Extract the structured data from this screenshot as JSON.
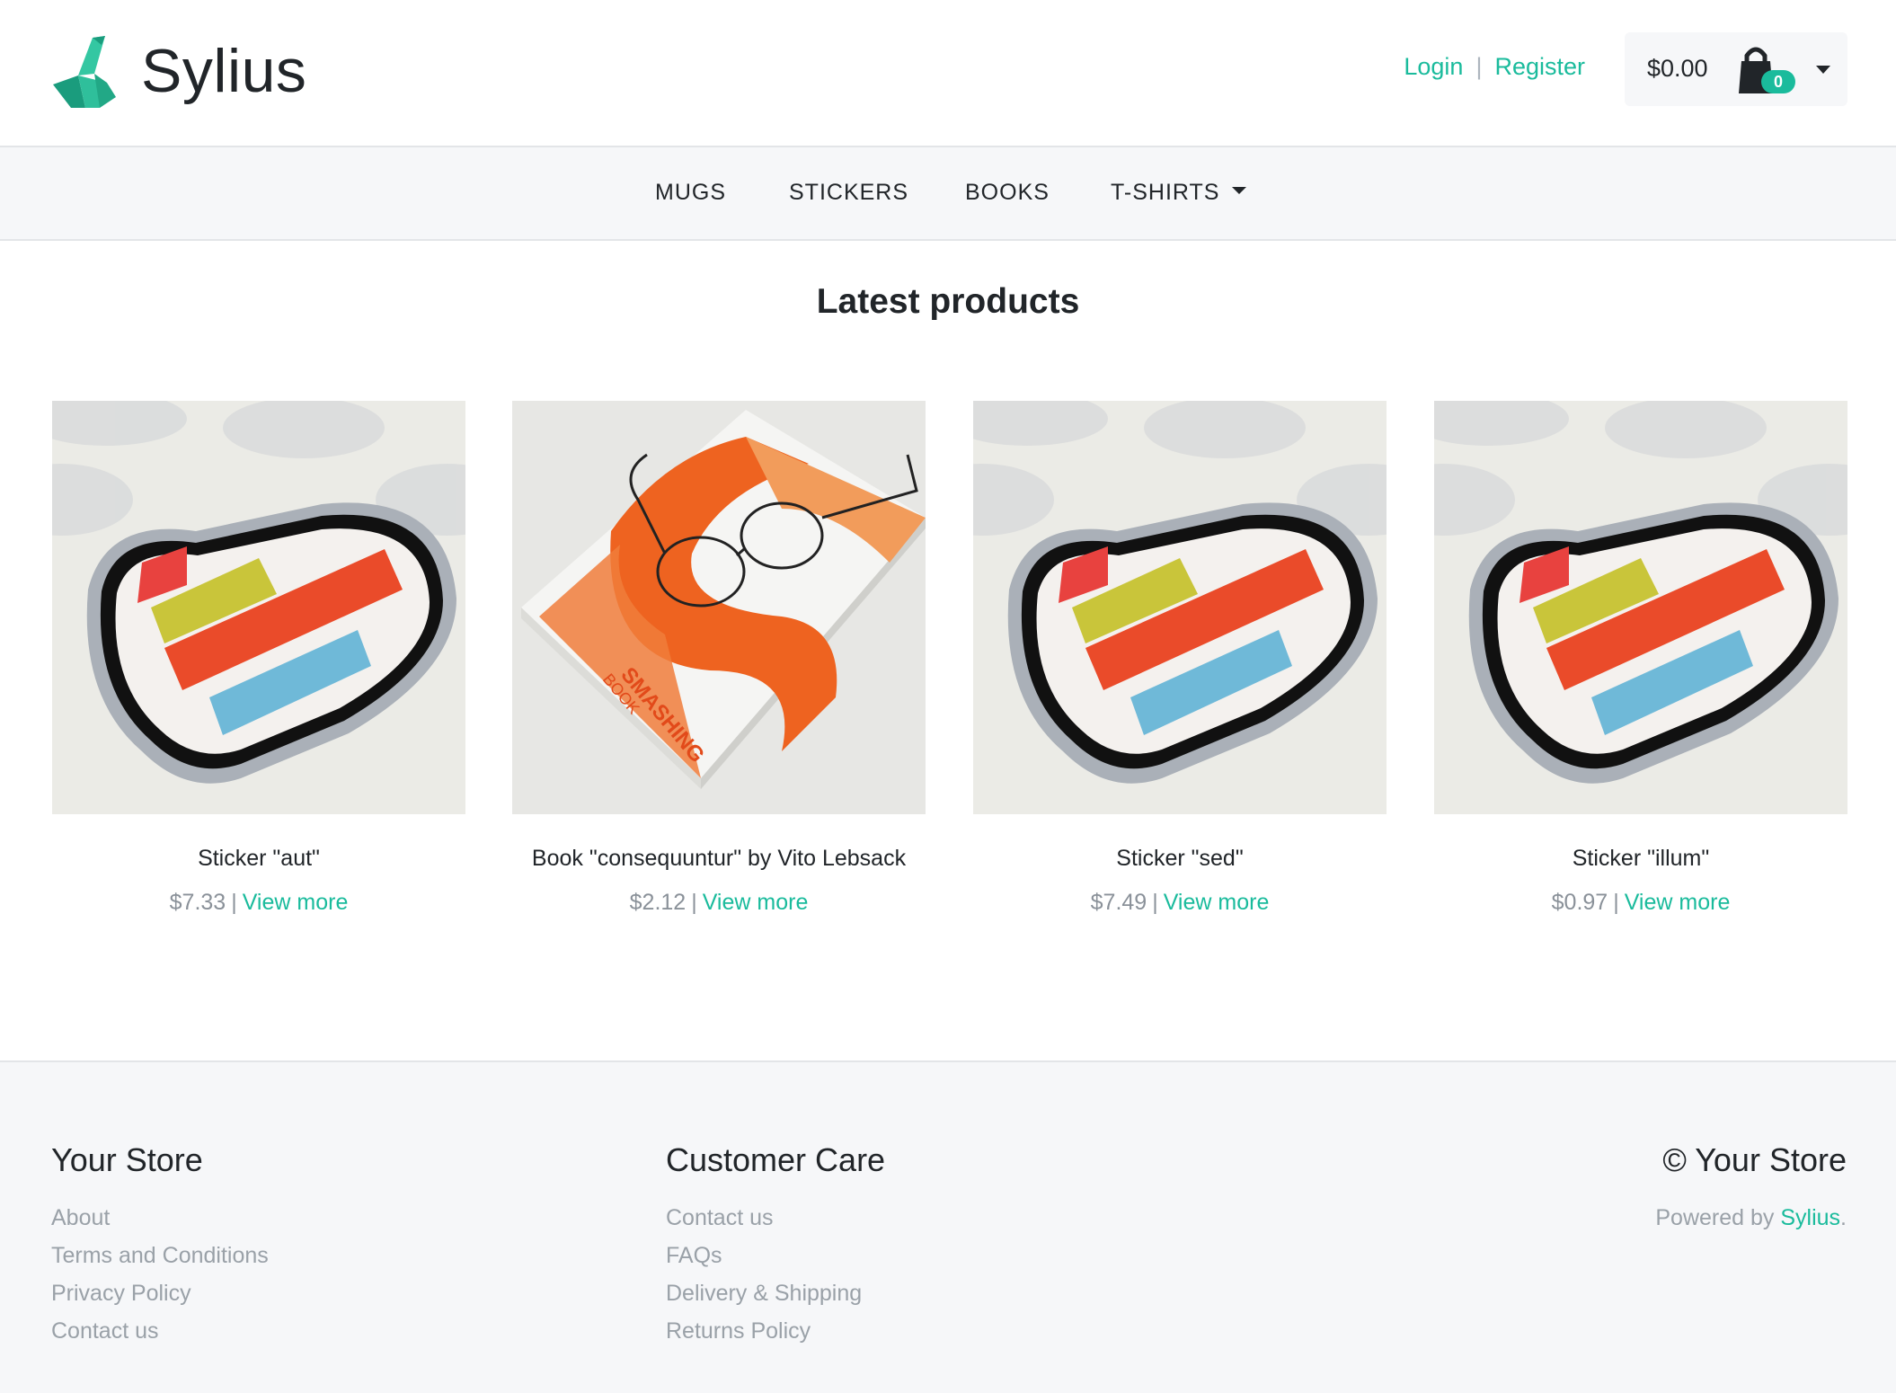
{
  "brand": {
    "name": "Sylius",
    "accent": "#1abb9c"
  },
  "header": {
    "login_label": "Login",
    "separator": "|",
    "register_label": "Register",
    "cart": {
      "total": "$0.00",
      "count": "0",
      "icon": "shopping-bag-icon"
    }
  },
  "nav": {
    "items": [
      {
        "label": "MUGS"
      },
      {
        "label": "STICKERS"
      },
      {
        "label": "BOOKS"
      },
      {
        "label": "T-SHIRTS",
        "has_dropdown": true
      }
    ]
  },
  "main": {
    "title": "Latest products",
    "products": [
      {
        "name": "Sticker \"aut\"",
        "price": "$7.33",
        "link": "View more",
        "image": "heart-sticker"
      },
      {
        "name": "Book \"consequuntur\" by Vito Lebsack",
        "price": "$2.12",
        "link": "View more",
        "image": "smashing-book"
      },
      {
        "name": "Sticker \"sed\"",
        "price": "$7.49",
        "link": "View more",
        "image": "heart-sticker"
      },
      {
        "name": "Sticker \"illum\"",
        "price": "$0.97",
        "link": "View more",
        "image": "heart-sticker"
      }
    ]
  },
  "footer": {
    "your_store": {
      "heading": "Your Store",
      "links": [
        "About",
        "Terms and Conditions",
        "Privacy Policy",
        "Contact us"
      ]
    },
    "customer_care": {
      "heading": "Customer Care",
      "links": [
        "Contact us",
        "FAQs",
        "Delivery & Shipping",
        "Returns Policy"
      ]
    },
    "copyright": {
      "heading": "© Your Store",
      "powered_prefix": "Powered by",
      "powered_link": "Sylius",
      "powered_suffix": "."
    }
  }
}
